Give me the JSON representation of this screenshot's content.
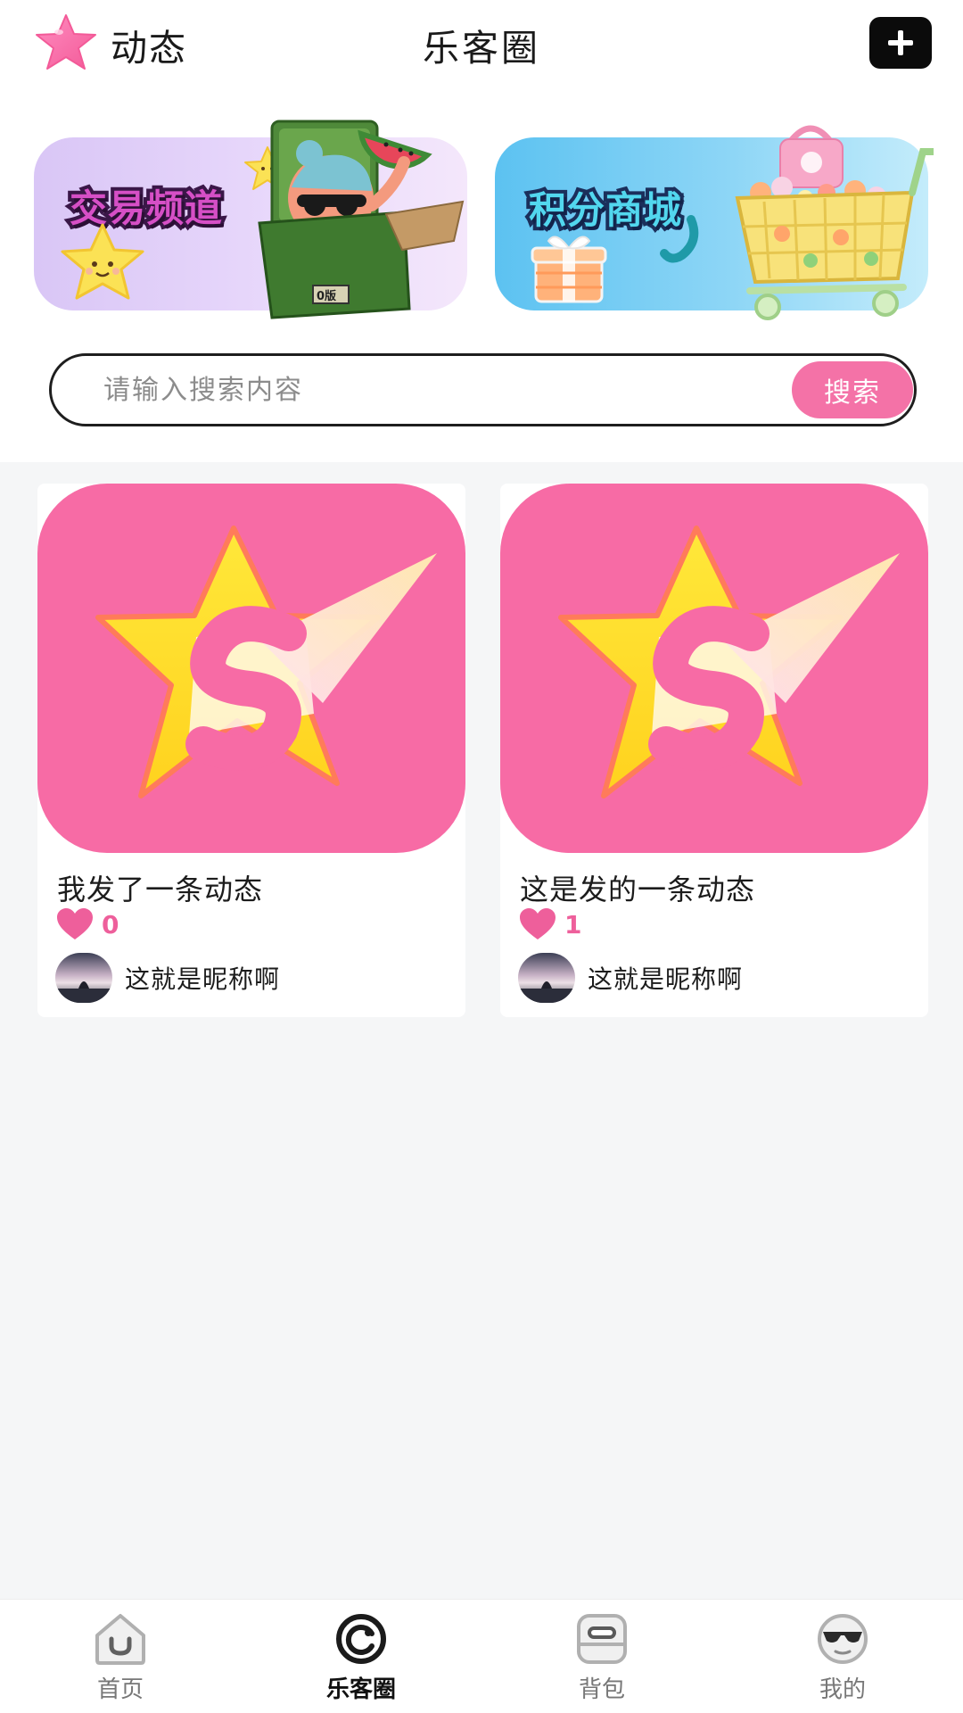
{
  "header": {
    "left_label": "动态",
    "title": "乐客圈",
    "add_icon": "plus-icon"
  },
  "banners": [
    {
      "title": "交易频道"
    },
    {
      "title": "积分商城"
    }
  ],
  "search": {
    "placeholder": "请输入搜索内容",
    "button_label": "搜索"
  },
  "posts": [
    {
      "title": "我发了一条动态",
      "likes": "0",
      "nickname": "这就是昵称啊"
    },
    {
      "title": "这是发的一条动态",
      "likes": "1",
      "nickname": "这就是昵称啊"
    }
  ],
  "tabs": [
    {
      "label": "首页",
      "icon": "home-icon",
      "active": false
    },
    {
      "label": "乐客圈",
      "icon": "circle-icon",
      "active": true
    },
    {
      "label": "背包",
      "icon": "backpack-icon",
      "active": false
    },
    {
      "label": "我的",
      "icon": "profile-icon",
      "active": false
    }
  ],
  "colors": {
    "accent_pink": "#f472a7",
    "like_pink": "#ee5f9b",
    "background": "#f5f6f7"
  }
}
